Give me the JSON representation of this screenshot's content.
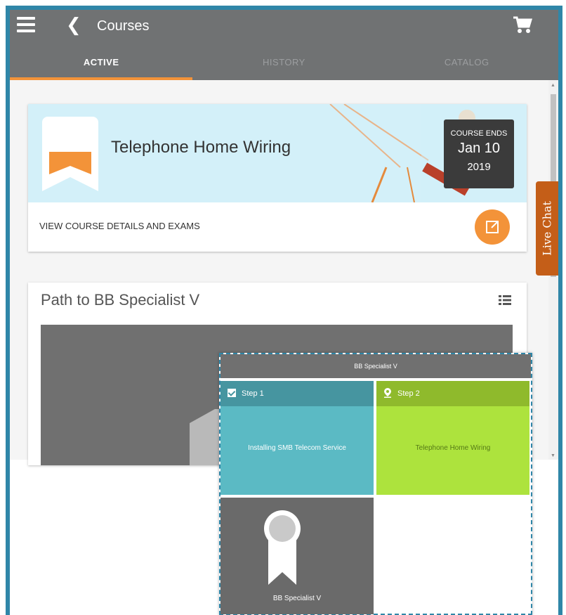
{
  "header": {
    "title": "Courses",
    "tabs": [
      {
        "label": "ACTIVE"
      },
      {
        "label": "HISTORY"
      },
      {
        "label": "CATALOG"
      }
    ]
  },
  "course": {
    "title": "Telephone Home Wiring",
    "ends_label": "COURSE ENDS",
    "ends_date": "Jan 10",
    "ends_year": "2019",
    "link_label": "VIEW COURSE DETAILS AND EXAMS"
  },
  "path": {
    "title": "Path to BB Specialist V"
  },
  "live_chat": {
    "label": "Live Chat"
  },
  "overlay": {
    "title": "BB Specialist V",
    "steps": [
      {
        "label": "Step 1",
        "name": "Installing SMB Telecom Service",
        "status": "completed"
      },
      {
        "label": "Step 2",
        "name": "Telephone Home Wiring",
        "status": "current"
      }
    ],
    "award": "BB Specialist V"
  },
  "colors": {
    "appbar": "#707273",
    "accent": "#f39339",
    "frame": "#2f86a8",
    "step1": "#5bbac4",
    "step2": "#ade33d",
    "live_chat": "#c45e18"
  }
}
